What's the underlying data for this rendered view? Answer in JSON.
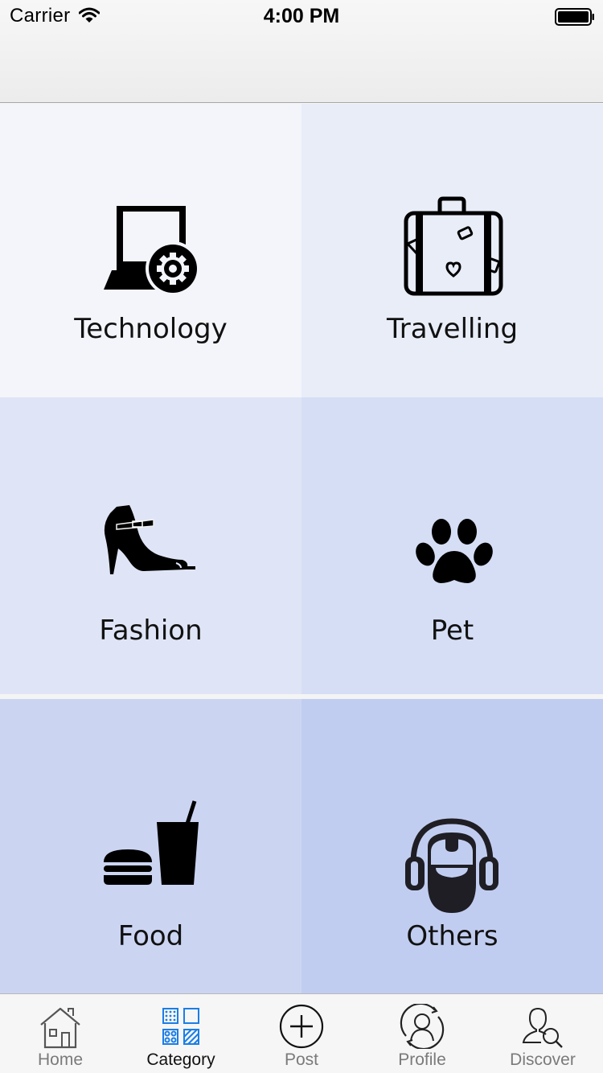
{
  "status_bar": {
    "carrier": "Carrier",
    "time": "4:00 PM",
    "wifi_icon": "wifi-icon",
    "battery_icon": "battery-icon"
  },
  "categories": [
    {
      "label": "Technology",
      "icon": "laptop-gear-icon",
      "color": "#f3f5fb"
    },
    {
      "label": "Travelling",
      "icon": "suitcase-icon",
      "color": "#e8edf8"
    },
    {
      "label": "Fashion",
      "icon": "high-heel-shoe-icon",
      "color": "#dfe5f6"
    },
    {
      "label": "Pet",
      "icon": "paw-icon",
      "color": "#d5def5"
    },
    {
      "label": "Food",
      "icon": "burger-drink-icon",
      "color": "#cbd5f2"
    },
    {
      "label": "Others",
      "icon": "headphones-person-icon",
      "color": "#c1cdf0"
    }
  ],
  "tabbar": {
    "active_tab": "Category",
    "active_color": "#1a7ee6",
    "tabs": [
      {
        "label": "Home",
        "icon": "home-icon"
      },
      {
        "label": "Category",
        "icon": "category-grid-icon"
      },
      {
        "label": "Post",
        "icon": "plus-circle-icon"
      },
      {
        "label": "Profile",
        "icon": "profile-sync-icon"
      },
      {
        "label": "Discover",
        "icon": "user-search-icon"
      }
    ]
  }
}
